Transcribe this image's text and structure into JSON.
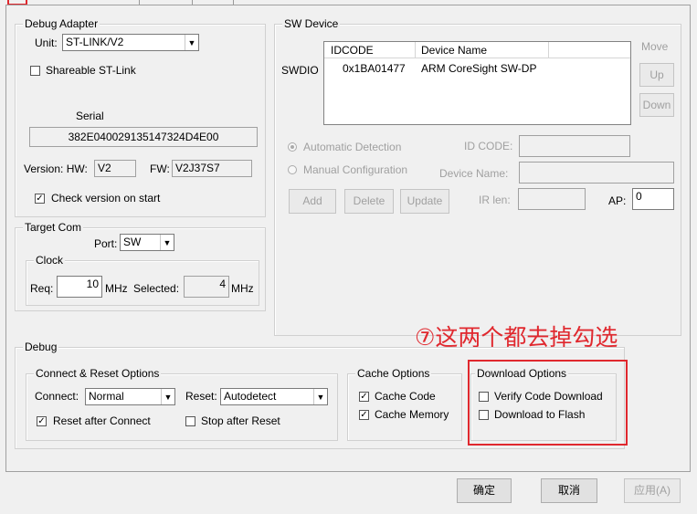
{
  "debug_adapter": {
    "title": "Debug Adapter",
    "unit_label": "Unit:",
    "unit_value": "ST-LINK/V2",
    "shareable_label": "Shareable ST-Link",
    "serial_label": "Serial",
    "serial_value": "382E040029135147324D4E00",
    "version_hw_label": "Version: HW:",
    "hw_value": "V2",
    "fw_label": "FW:",
    "fw_value": "V2J37S7",
    "check_version_label": "Check version on start"
  },
  "target_com": {
    "title": "Target Com",
    "port_label": "Port:",
    "port_value": "SW",
    "clock_title": "Clock",
    "req_label": "Req:",
    "req_value": "10",
    "mhz1": "MHz",
    "selected_label": "Selected:",
    "selected_value": "4",
    "mhz2": "MHz"
  },
  "sw_device": {
    "title": "SW Device",
    "swdio_label": "SWDIO",
    "col_idcode": "IDCODE",
    "col_device_name": "Device Name",
    "row_idcode": "0x1BA01477",
    "row_device_name": "ARM CoreSight SW-DP",
    "move_label": "Move",
    "up_label": "Up",
    "down_label": "Down",
    "auto_detect": "Automatic Detection",
    "manual_config": "Manual Configuration",
    "id_code_label": "ID CODE:",
    "device_name_label": "Device Name:",
    "add_btn": "Add",
    "delete_btn": "Delete",
    "update_btn": "Update",
    "ir_len_label": "IR len:",
    "ap_label": "AP:",
    "ap_value": "0"
  },
  "debug": {
    "title": "Debug",
    "connect_reset_title": "Connect & Reset Options",
    "connect_label": "Connect:",
    "connect_value": "Normal",
    "reset_label": "Reset:",
    "reset_value": "Autodetect",
    "reset_after_connect": "Reset after Connect",
    "stop_after_reset": "Stop after Reset",
    "cache_title": "Cache Options",
    "cache_code": "Cache Code",
    "cache_memory": "Cache Memory",
    "download_title": "Download Options",
    "verify_code": "Verify Code Download",
    "download_flash": "Download to Flash"
  },
  "annotation": "⑦这两个都去掉勾选",
  "footer": {
    "ok": "确定",
    "cancel": "取消",
    "apply": "应用(A)"
  },
  "colors": {
    "annotation_red": "#e0282e",
    "background": "#f0f0f0"
  }
}
